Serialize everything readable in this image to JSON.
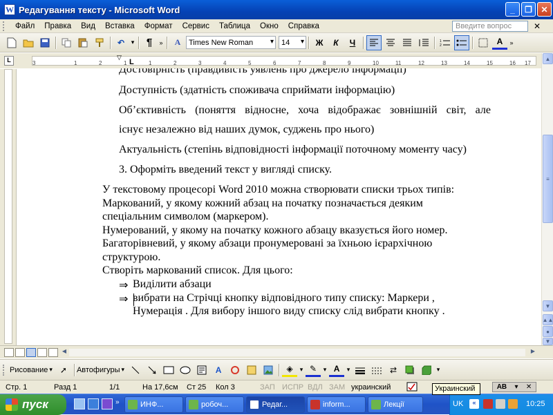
{
  "window": {
    "title": "Редагування тексту - Microsoft Word",
    "app_icon": "W"
  },
  "menubar": {
    "items": [
      "Файл",
      "Правка",
      "Вид",
      "Вставка",
      "Формат",
      "Сервис",
      "Таблица",
      "Окно",
      "Справка"
    ],
    "help_placeholder": "Введите вопрос"
  },
  "toolbar": {
    "font_name": "Times New Roman",
    "font_size": "14",
    "bold": "Ж",
    "italic": "К",
    "underline": "Ч",
    "pilcrow": "¶"
  },
  "ruler": {
    "ticks": [
      "3",
      "1",
      "2",
      "1",
      "1",
      "2",
      "3",
      "4",
      "5",
      "6",
      "7",
      "8",
      "9",
      "10",
      "11",
      "12",
      "13",
      "14",
      "15",
      "16",
      "17"
    ]
  },
  "document": {
    "lines": [
      "Достовірність (правдивість уявлень про джерело інформації)",
      "Доступність (здатність споживача сприймати інформацію)",
      "Об’єктивність  (поняття  відносне,  хоча  відображає  зовнішній  світ,  але",
      "існує незалежно від наших думок, суджень про нього)",
      "Актуальність (степінь відповідності інформації поточному моменту часу)",
      "3.  Оформіть введений текст у вигляді списку.",
      "У текстовому процесорі Word 2010 можна створювати списки трьох типів:",
      "Маркований, у якому кожний абзац на початку позначається деяким",
      "спеціальним символом (маркером).",
      "Нумерований, у якому на початку кожного абзацу вказується його номер.",
      "Багаторівневий, у якому абзаци пронумеровані за їхньою ієрархічною",
      "структурою.",
      "Створіть маркований список. Для цього:",
      "Виділити  абзаци",
      "вибрати на Стрічці кнопку відповідного типу списку: Маркери ,",
      "Нумерація . Для вибору іншого виду списку слід вибрати кнопку ."
    ],
    "bullet": "⇒"
  },
  "drawbar": {
    "draw_label": "Рисование",
    "autoshapes_label": "Автофигуры"
  },
  "statusbar": {
    "page": "Стр. 1",
    "section": "Разд 1",
    "pages": "1/1",
    "at": "На 17,6см",
    "line": "Ст 25",
    "col": "Кол 3",
    "rec": "ЗАП",
    "trk": "ИСПР",
    "ext": "ВДЛ",
    "ovr": "ЗАМ",
    "language": "украинский"
  },
  "tooltip": {
    "text": "Украинский"
  },
  "taskbar": {
    "start": "пуск",
    "tasks": [
      "ИНФ...",
      "робоч...",
      "Редаг...",
      "inform...",
      "Лекції"
    ],
    "lang": "UK",
    "clock": "10:25"
  }
}
